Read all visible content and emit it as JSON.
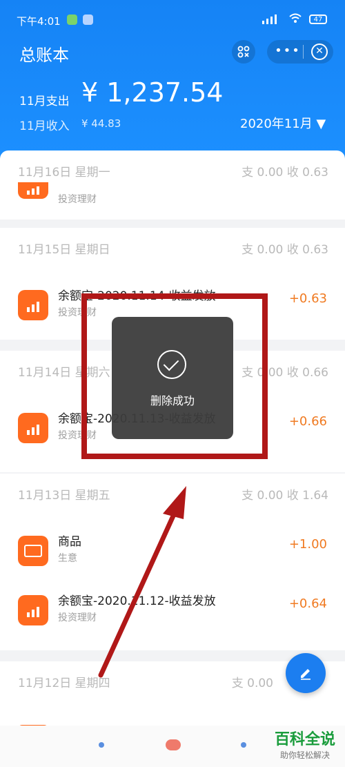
{
  "status_bar": {
    "time": "下午4:01",
    "battery": "47"
  },
  "header": {
    "title": "总账本",
    "spend_label": "11月支出",
    "spend_amount": "¥ 1,237.54",
    "income_label": "11月收入",
    "income_amount": "¥ 44.83",
    "month_picker": "2020年11月 ▼",
    "more_icon_text": "•••",
    "close_icon_text": "✕"
  },
  "days": [
    {
      "date": "11月16日 星期一",
      "summary": "支 0.00   收 0.63",
      "entries": [
        {
          "title": "",
          "sub": "投资理财",
          "amount": ""
        }
      ]
    },
    {
      "date": "11月15日 星期日",
      "summary": "支 0.00   收 0.63",
      "entries": [
        {
          "title": "余额宝-2020.11.14-收益发放",
          "sub": "投资理财",
          "amount": "+0.63"
        }
      ]
    },
    {
      "date": "11月14日 星期六",
      "summary": "支 0.00   收 0.66",
      "entries": [
        {
          "title": "余额宝-2020.11.13-收益发放",
          "sub": "投资理财",
          "amount": "+0.66"
        }
      ]
    },
    {
      "date": "11月13日 星期五",
      "summary": "支 0.00   收 1.64",
      "entries": [
        {
          "title": "商品",
          "sub": "生意",
          "amount": "+1.00"
        },
        {
          "title": "余额宝-2020.11.12-收益发放",
          "sub": "投资理财",
          "amount": "+0.64"
        }
      ]
    },
    {
      "date": "11月12日 星期四",
      "summary": "支 0.00",
      "entries": []
    }
  ],
  "toast": {
    "text": "删除成功"
  },
  "watermark": {
    "title": "百科全说",
    "sub": "助你轻松解决"
  },
  "colors": {
    "header_blue": "#1a8bfb",
    "income_orange": "#f07a21",
    "icon_orange": "#ff6a1f",
    "annotation_red": "#b01818"
  }
}
